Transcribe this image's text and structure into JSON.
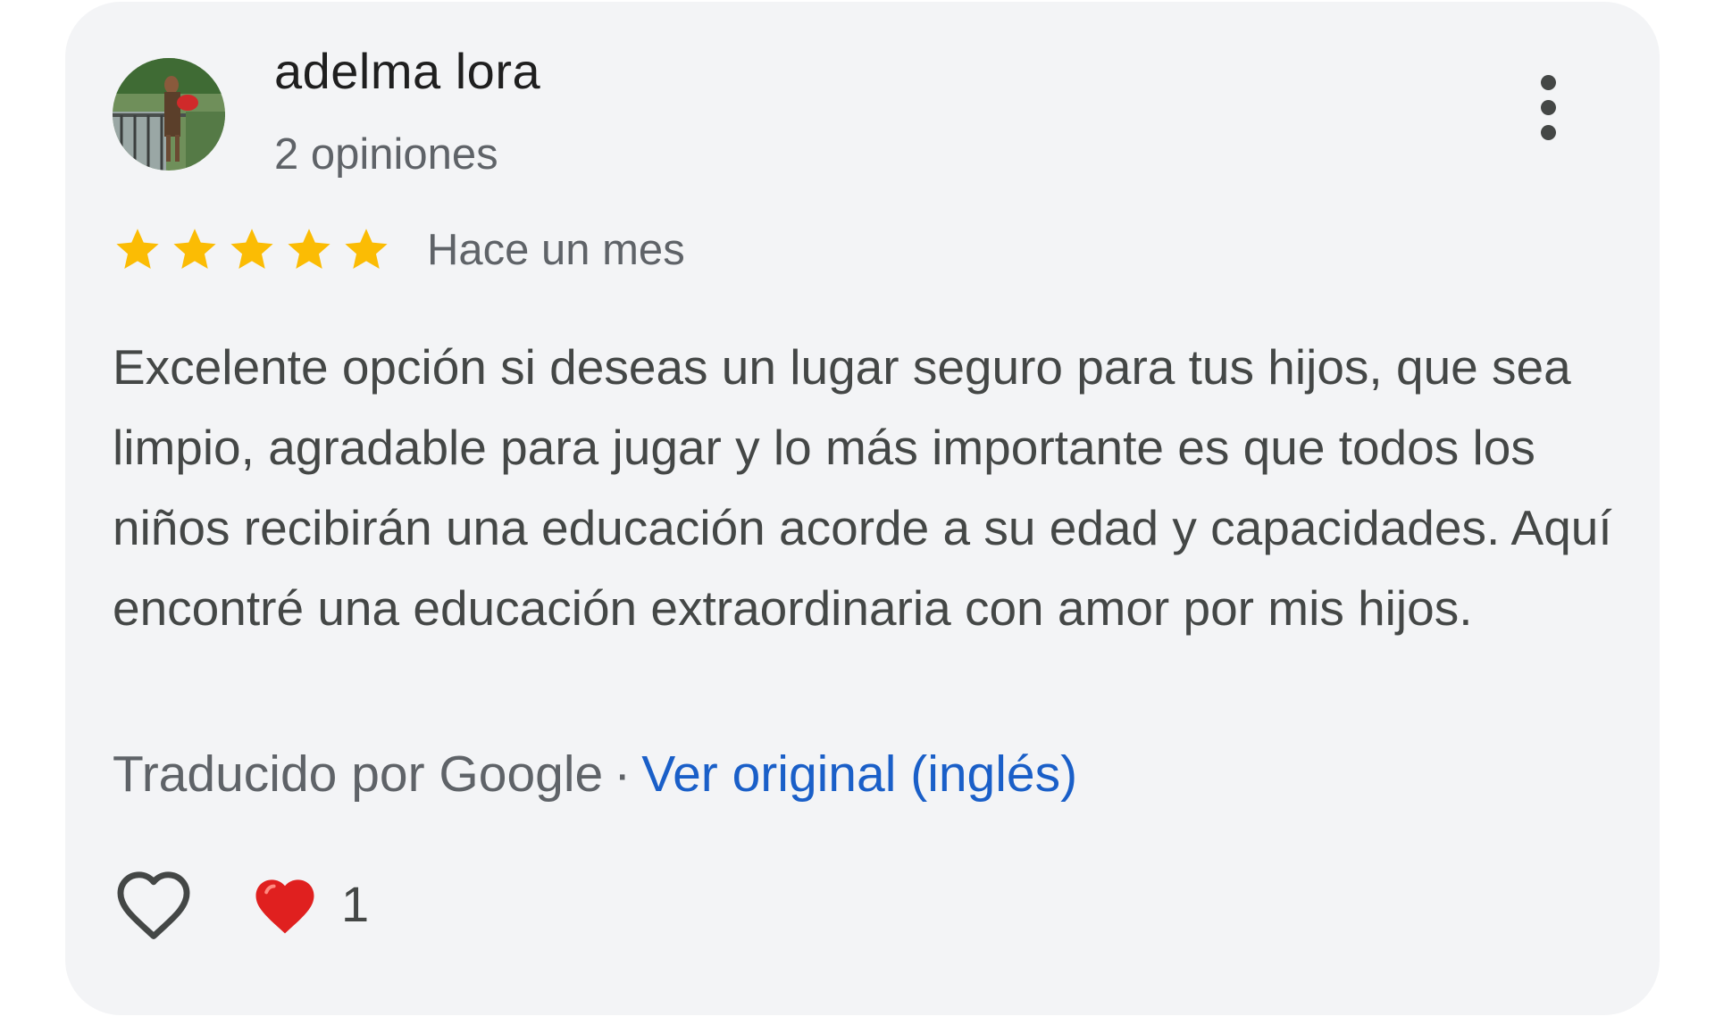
{
  "review": {
    "author": {
      "name": "adelma lora",
      "reviews_count": "2 opiniones"
    },
    "rating": {
      "stars": 5,
      "max_stars": 5,
      "star_color": "#fbbc04"
    },
    "date": "Hace un mes",
    "text": "Excelente opción si deseas un lugar seguro para tus hijos, que sea limpio, agradable para jugar y lo más importante es que todos los niños recibirán una educación acorde a su edad y capacidades. Aquí encontré una educación extraordinaria con amor por mis hijos.",
    "translation": {
      "label": "Traducido por Google",
      "separator": "·",
      "link": "Ver original (inglés)",
      "link_color": "#1a5fc8"
    },
    "reactions": {
      "like_icon": "heart-outline-icon",
      "reaction_icon": "red-heart-emoji",
      "count": "1"
    },
    "menu_icon": "more-vert-icon"
  }
}
